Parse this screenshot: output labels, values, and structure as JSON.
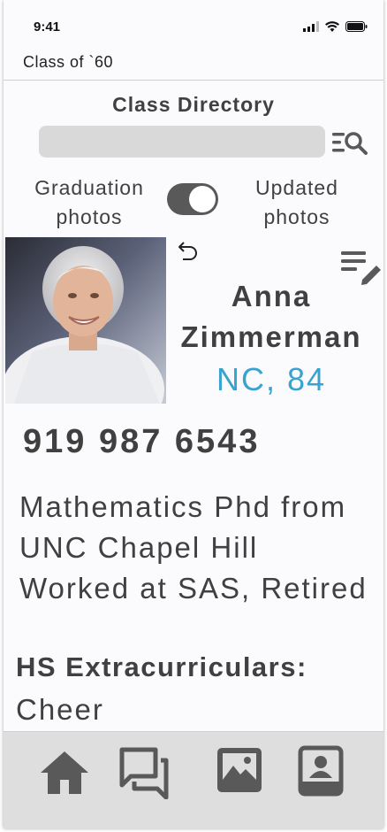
{
  "status_bar": {
    "time": "9:41"
  },
  "nav": {
    "title": "Class of `60"
  },
  "directory": {
    "title": "Class Directory",
    "search_placeholder": ""
  },
  "toggle": {
    "left_label": "Graduation photos",
    "right_label": "Updated photos",
    "state": "updated"
  },
  "profile": {
    "name": "Anna Zimmerman",
    "location": "NC, 84",
    "phone": "919 987 6543",
    "bio": "Mathematics Phd from UNC Chapel Hill Worked at SAS, Retired",
    "extracurriculars_label": "HS Extracurriculars:",
    "extracurriculars": "Cheer"
  },
  "tabs": [
    {
      "icon": "home-icon"
    },
    {
      "icon": "chat-icon"
    },
    {
      "icon": "gallery-icon"
    },
    {
      "icon": "contacts-book-icon"
    }
  ],
  "colors": {
    "accent": "#39a3cf",
    "text": "#404040",
    "icon": "#595959",
    "tabbar_bg": "#dedede"
  }
}
